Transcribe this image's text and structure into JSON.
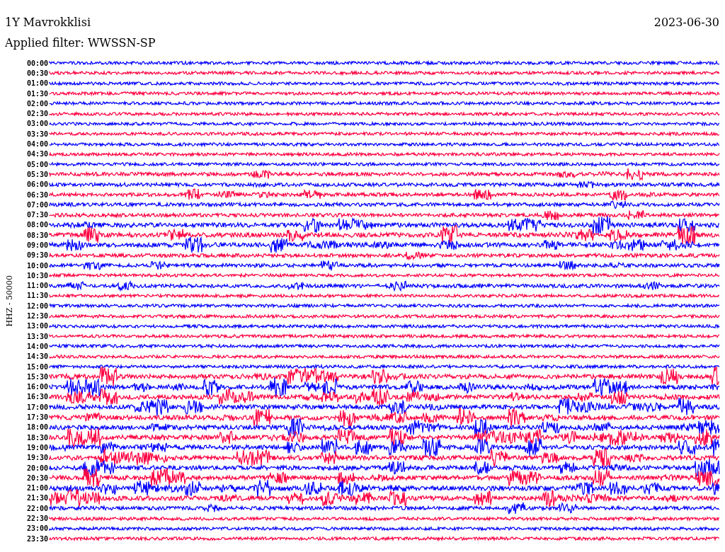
{
  "station": "1Y Mavrokklisi",
  "date": "2023-06-30",
  "filter": "Applied filter: WWSSN-SP",
  "axis_label": "HHZ - 50000",
  "traces": [
    {
      "time": "00:00",
      "color": "#0000ff",
      "kind": "quiet"
    },
    {
      "time": "00:30",
      "color": "#ff0040",
      "kind": "quiet"
    },
    {
      "time": "01:00",
      "color": "#0000ff",
      "kind": "quiet"
    },
    {
      "time": "01:30",
      "color": "#ff0040",
      "kind": "quiet"
    },
    {
      "time": "02:00",
      "color": "#0000ff",
      "kind": "quiet"
    },
    {
      "time": "02:30",
      "color": "#ff0040",
      "kind": "quiet"
    },
    {
      "time": "03:00",
      "color": "#0000ff",
      "kind": "quiet"
    },
    {
      "time": "03:30",
      "color": "#ff0040",
      "kind": "quiet"
    },
    {
      "time": "04:00",
      "color": "#0000ff",
      "kind": "quiet"
    },
    {
      "time": "04:30",
      "color": "#ff0040",
      "kind": "quiet"
    },
    {
      "time": "05:00",
      "color": "#0000ff",
      "kind": "quiet"
    },
    {
      "time": "05:30",
      "color": "#ff0040",
      "kind": "moderate"
    },
    {
      "time": "06:00",
      "color": "#0000ff",
      "kind": "moderate"
    },
    {
      "time": "06:30",
      "color": "#ff0040",
      "kind": "moderate"
    },
    {
      "time": "07:00",
      "color": "#0000ff",
      "kind": "moderate"
    },
    {
      "time": "07:30",
      "color": "#ff0040",
      "kind": "moderate"
    },
    {
      "time": "08:00",
      "color": "#0000ff",
      "kind": "strong"
    },
    {
      "time": "08:30",
      "color": "#ff0040",
      "kind": "strong"
    },
    {
      "time": "09:00",
      "color": "#0000ff",
      "kind": "strong"
    },
    {
      "time": "09:30",
      "color": "#ff0040",
      "kind": "moderate"
    },
    {
      "time": "10:00",
      "color": "#0000ff",
      "kind": "moderate"
    },
    {
      "time": "10:30",
      "color": "#ff0040",
      "kind": "quiet"
    },
    {
      "time": "11:00",
      "color": "#0000ff",
      "kind": "moderate"
    },
    {
      "time": "11:30",
      "color": "#ff0040",
      "kind": "quiet"
    },
    {
      "time": "12:00",
      "color": "#0000ff",
      "kind": "quiet"
    },
    {
      "time": "12:30",
      "color": "#ff0040",
      "kind": "quiet"
    },
    {
      "time": "13:00",
      "color": "#0000ff",
      "kind": "quiet"
    },
    {
      "time": "13:30",
      "color": "#ff0040",
      "kind": "quiet"
    },
    {
      "time": "14:00",
      "color": "#0000ff",
      "kind": "quiet"
    },
    {
      "time": "14:30",
      "color": "#ff0040",
      "kind": "quiet"
    },
    {
      "time": "15:00",
      "color": "#0000ff",
      "kind": "quiet"
    },
    {
      "time": "15:30",
      "color": "#ff0040",
      "kind": "strong"
    },
    {
      "time": "16:00",
      "color": "#0000ff",
      "kind": "strong"
    },
    {
      "time": "16:30",
      "color": "#ff0040",
      "kind": "strong"
    },
    {
      "time": "17:00",
      "color": "#0000ff",
      "kind": "strong"
    },
    {
      "time": "17:30",
      "color": "#ff0040",
      "kind": "strong"
    },
    {
      "time": "18:00",
      "color": "#0000ff",
      "kind": "strong"
    },
    {
      "time": "18:30",
      "color": "#ff0040",
      "kind": "strong"
    },
    {
      "time": "19:00",
      "color": "#0000ff",
      "kind": "strong"
    },
    {
      "time": "19:30",
      "color": "#ff0040",
      "kind": "strong"
    },
    {
      "time": "20:00",
      "color": "#0000ff",
      "kind": "strong"
    },
    {
      "time": "20:30",
      "color": "#ff0040",
      "kind": "strong"
    },
    {
      "time": "21:00",
      "color": "#0000ff",
      "kind": "strong"
    },
    {
      "time": "21:30",
      "color": "#ff0040",
      "kind": "strong"
    },
    {
      "time": "22:00",
      "color": "#0000ff",
      "kind": "moderate"
    },
    {
      "time": "22:30",
      "color": "#ff0040",
      "kind": "quiet"
    },
    {
      "time": "23:00",
      "color": "#0000ff",
      "kind": "quiet"
    },
    {
      "time": "23:30",
      "color": "#ff0040",
      "kind": "quiet"
    }
  ]
}
